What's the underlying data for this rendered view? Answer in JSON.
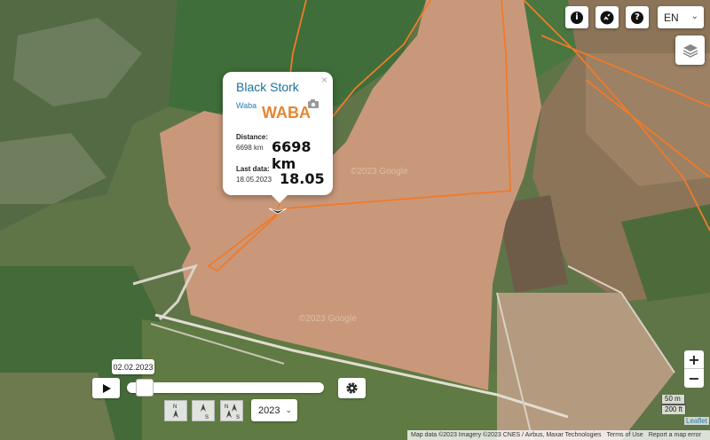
{
  "map": {
    "track_color": "#f07a2a",
    "water_color": "#c9987a",
    "field_color": "#5d7a3e",
    "watermark": "©2023 Google"
  },
  "controls": {
    "info_icon": "info-icon",
    "link_icon": "link-icon",
    "help_icon": "help-icon",
    "language": "EN",
    "layers_icon": "layers-icon"
  },
  "popup": {
    "title": "Black Stork",
    "subname": "Waba",
    "name_large": "WABA",
    "distance_label": "Distance:",
    "distance_small": "6698 km",
    "distance_large": "6698 km",
    "last_data_label": "Last data:",
    "last_data_small": "18.05.2023",
    "last_data_large": "18.05",
    "close": "×"
  },
  "timeline": {
    "current_date": "02.02.2023",
    "position": 0.05,
    "year": "2023",
    "direction_buttons": [
      {
        "name": "north-arrow-icon",
        "top": "N",
        "bottom": ""
      },
      {
        "name": "south-arrow-icon",
        "top": "",
        "bottom": "S"
      },
      {
        "name": "north-south-arrows-icon",
        "top": "N",
        "bottom": "S"
      }
    ]
  },
  "zoom": {
    "in": "+",
    "out": "−"
  },
  "scale": {
    "metric": "50 m",
    "imperial": "200 ft"
  },
  "attribution": {
    "leaflet": "Leaflet",
    "data": "Map data ©2023 Imagery ©2023 CNES / Airbus, Maxar Technologies",
    "terms": "Terms of Use",
    "report": "Report a map error"
  }
}
